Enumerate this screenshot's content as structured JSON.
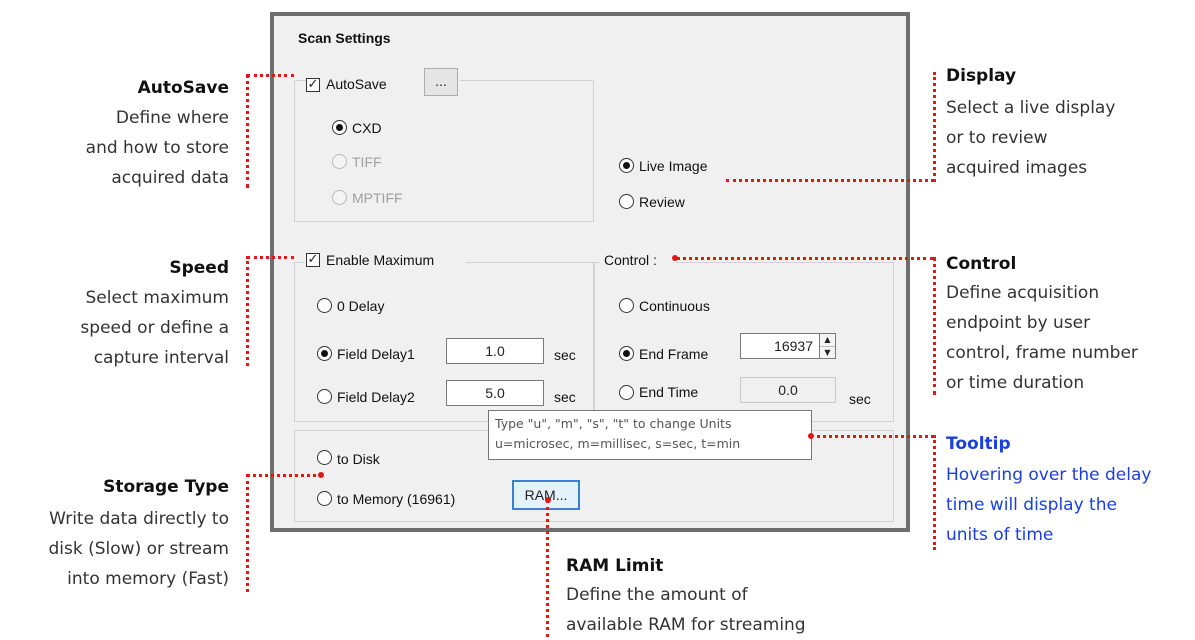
{
  "panel": {
    "title": "Scan Settings",
    "autosave": {
      "label": "AutoSave",
      "checked": true,
      "browse_label": "..."
    },
    "format": [
      {
        "label": "CXD",
        "selected": true,
        "enabled": true
      },
      {
        "label": "TIFF",
        "selected": false,
        "enabled": false
      },
      {
        "label": "MPTIFF",
        "selected": false,
        "enabled": false
      }
    ],
    "display": [
      {
        "label": "Live Image",
        "selected": true
      },
      {
        "label": "Review",
        "selected": false
      }
    ],
    "speed": {
      "enable_label": "Enable Maximum",
      "zero_delay_label": "0 Delay",
      "field_delay1_label": "Field Delay1",
      "field_delay1_value": "1.0",
      "field_delay2_label": "Field Delay2",
      "field_delay2_value": "5.0",
      "unit": "sec"
    },
    "control": {
      "title": "Control :",
      "continuous_label": "Continuous",
      "end_frame_label": "End Frame",
      "end_frame_value": "16937",
      "end_time_label": "End Time",
      "end_time_value": "0.0",
      "unit": "sec"
    },
    "storage": {
      "disk_label": "to Disk",
      "memory_label": "to Memory (16961)",
      "ram_button": "RAM..."
    },
    "tooltip": {
      "line1": "Type \"u\", \"m\", \"s\", \"t\" to change Units",
      "line2": "u=microsec, m=millisec, s=sec, t=min"
    }
  },
  "annotations": {
    "autosave": {
      "title": "AutoSave",
      "lines": [
        "Define where",
        "and how to store",
        "acquired data"
      ]
    },
    "speed": {
      "title": "Speed",
      "lines": [
        "Select maximum",
        "speed or define a",
        "capture interval"
      ]
    },
    "storage": {
      "title": "Storage Type",
      "lines": [
        "Write data directly to",
        "disk (Slow) or stream",
        "into memory (Fast)"
      ]
    },
    "ram": {
      "title": "RAM Limit",
      "lines": [
        "Define the amount of",
        "available RAM for streaming"
      ]
    },
    "display": {
      "title": "Display",
      "lines": [
        "Select a live display",
        "or to review",
        "acquired images"
      ]
    },
    "control": {
      "title": "Control",
      "lines": [
        "Define acquisition",
        "endpoint by user",
        "control, frame number",
        "or time duration"
      ]
    },
    "tooltip": {
      "title": "Tooltip",
      "lines": [
        "Hovering over the delay",
        "time will display the",
        "units of time"
      ],
      "color": "#1a3fe0"
    }
  },
  "colors": {
    "leader": "#e01818",
    "panel_border": "#6e6e6e",
    "focus": "#3c7fd6"
  }
}
